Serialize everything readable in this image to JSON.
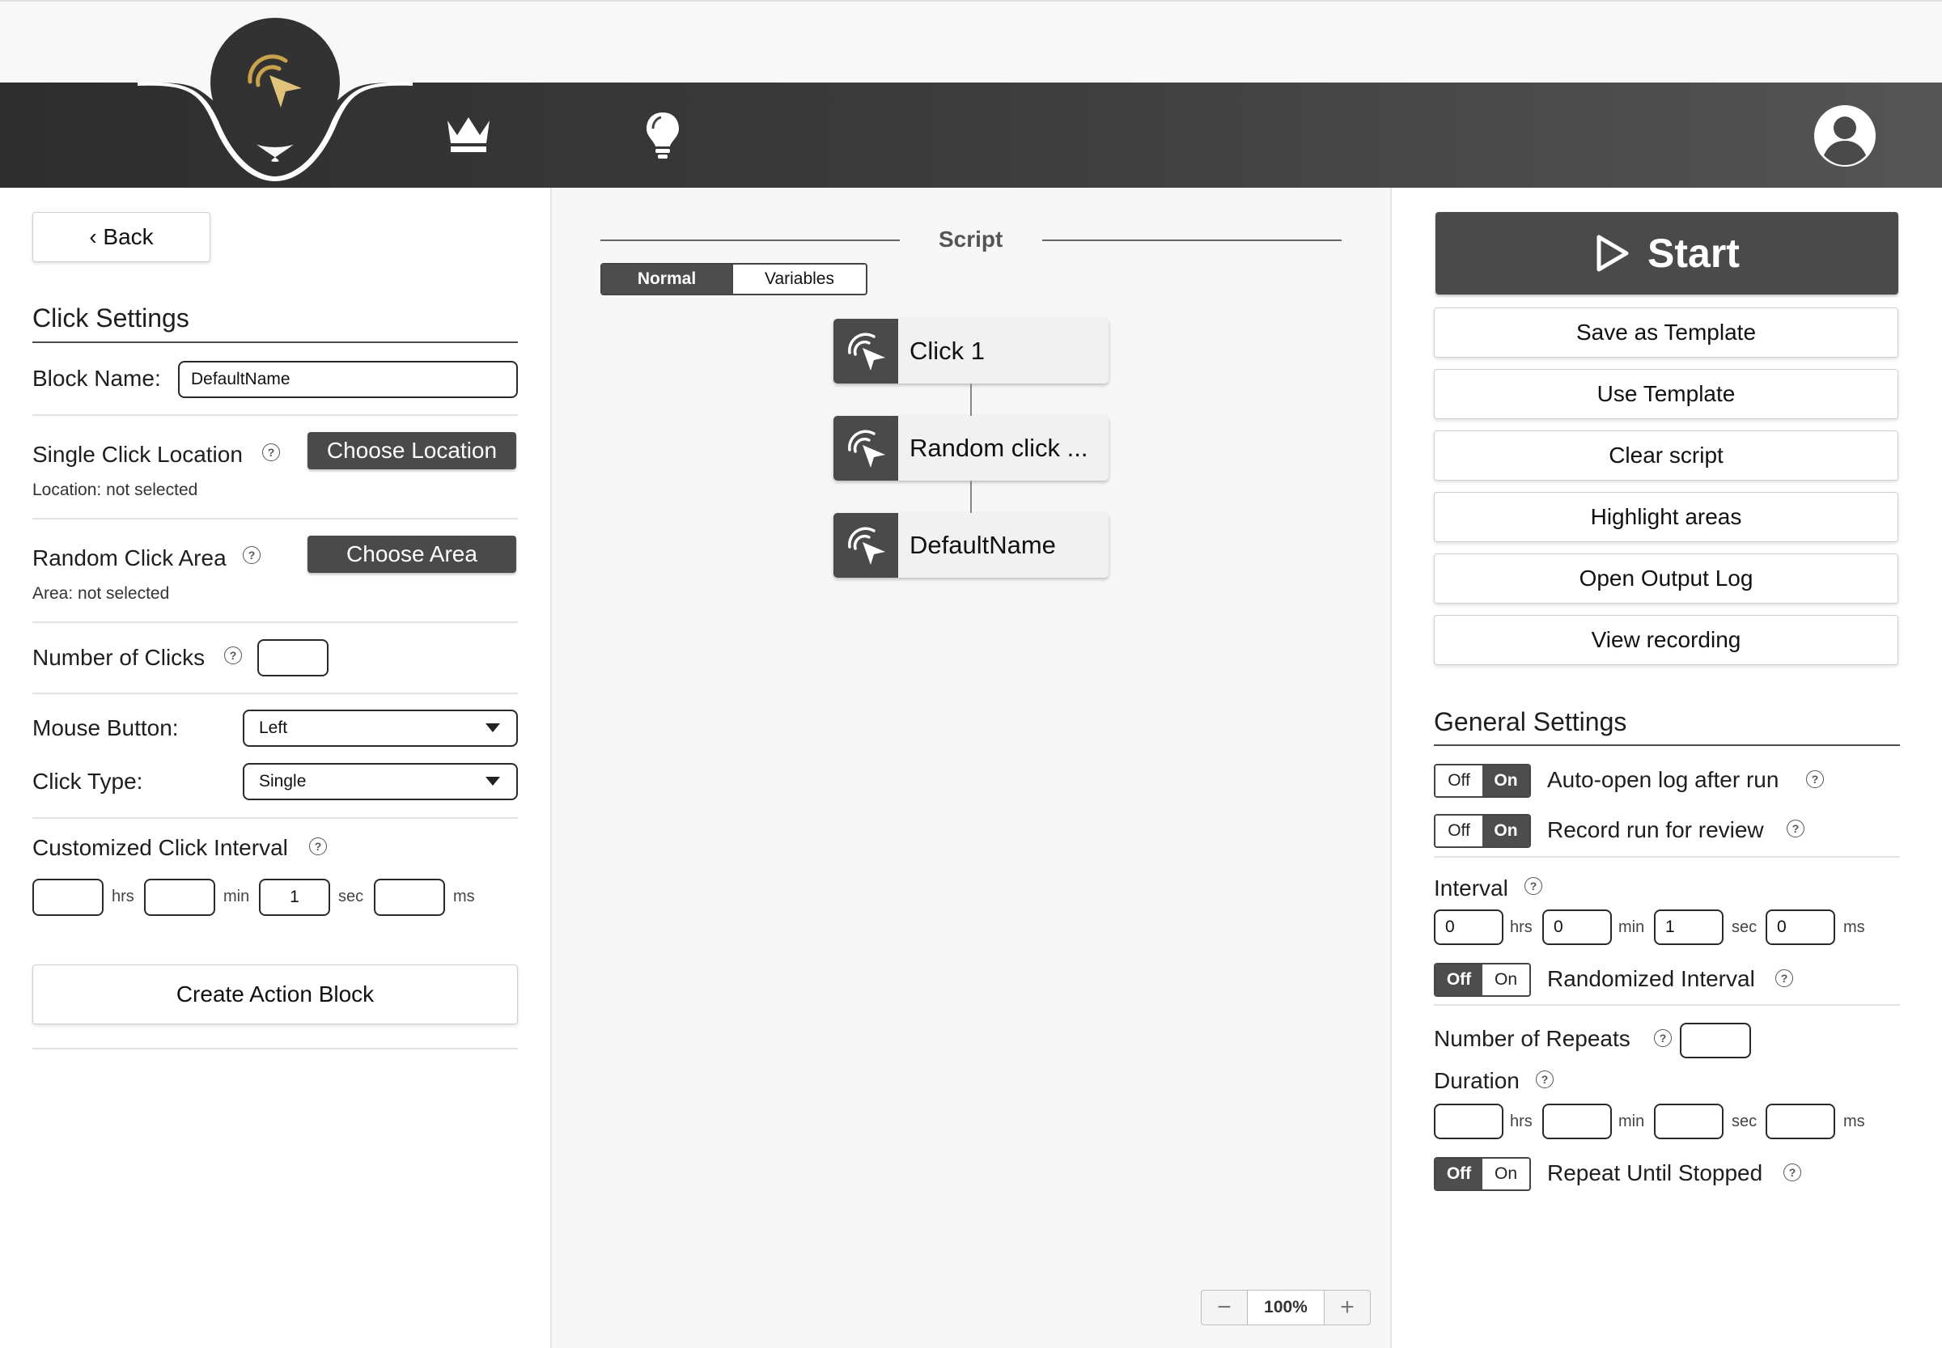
{
  "header": {
    "logo_icon": "click-cursor-logo-icon",
    "nav_icons": [
      "crown-icon",
      "lightbulb-icon",
      "user-avatar-icon"
    ],
    "accent_color": "#c9a34a"
  },
  "left": {
    "back_label": "‹ Back",
    "section_title": "Click Settings",
    "block_name_label": "Block Name:",
    "block_name_value": "DefaultName",
    "single_click_label": "Single Click Location",
    "choose_location_label": "Choose Location",
    "location_status": "Location: not selected",
    "random_area_label": "Random Click Area",
    "choose_area_label": "Choose Area",
    "area_status": "Area: not selected",
    "num_clicks_label": "Number of Clicks",
    "num_clicks_value": "",
    "mouse_button_label": "Mouse Button:",
    "mouse_button_value": "Left",
    "click_type_label": "Click Type:",
    "click_type_value": "Single",
    "custom_interval_label": "Customized Click Interval",
    "interval": {
      "hrs": "",
      "min": "",
      "sec": "1",
      "ms": ""
    },
    "units": {
      "hrs": "hrs",
      "min": "min",
      "sec": "sec",
      "ms": "ms"
    },
    "create_label": "Create Action Block"
  },
  "center": {
    "script_label": "Script",
    "tabs": {
      "normal": "Normal",
      "variables": "Variables"
    },
    "blocks": [
      {
        "label": "Click 1"
      },
      {
        "label": "Random click ..."
      },
      {
        "label": "DefaultName"
      }
    ],
    "zoom": {
      "minus": "−",
      "value": "100%",
      "plus": "+"
    }
  },
  "right": {
    "start_label": "Start",
    "buttons": [
      "Save as Template",
      "Use Template",
      "Clear script",
      "Highlight areas",
      "Open Output Log",
      "View recording"
    ],
    "general_title": "General Settings",
    "toggle_off": "Off",
    "toggle_on": "On",
    "auto_open_label": "Auto-open log after run",
    "record_label": "Record run for review",
    "interval_label": "Interval",
    "interval": {
      "hrs": "0",
      "min": "0",
      "sec": "1",
      "ms": "0"
    },
    "randomized_label": "Randomized Interval",
    "repeats_label": "Number of Repeats",
    "repeats_value": "",
    "duration_label": "Duration",
    "duration": {
      "hrs": "",
      "min": "",
      "sec": "",
      "ms": ""
    },
    "repeat_until_label": "Repeat Until Stopped",
    "auto_open_state": "On",
    "record_state": "On",
    "randomized_state": "Off",
    "repeat_until_state": "Off"
  },
  "help_glyph": "?"
}
